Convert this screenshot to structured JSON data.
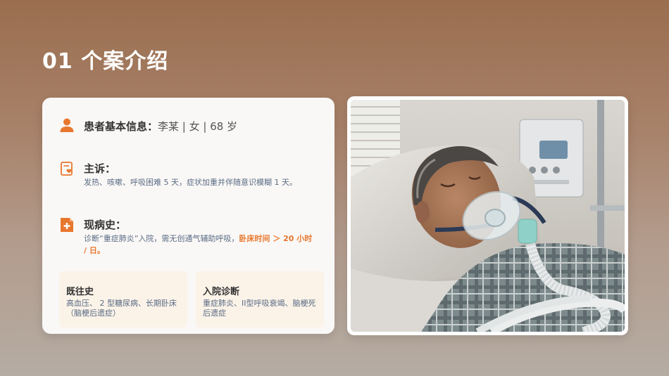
{
  "title": "01  个案介绍",
  "patient": {
    "label": "患者基本信息：",
    "value": "李某 | 女 | 68 岁",
    "icon": "person-icon"
  },
  "complaint": {
    "label": "主诉：",
    "text": "发热、咳嗽、呼吸困难 5 天，症状加重并伴随意识模糊 1 天。",
    "icon": "clipboard-heart-icon"
  },
  "history": {
    "label": "现病史：",
    "text": "诊断“重症肺炎”入院，需无创通气辅助呼吸，",
    "highlight": "卧床时间 ＞ 20 小时 / 日。",
    "icon": "medical-file-icon"
  },
  "past": {
    "label": "既往史",
    "text": "高血压、 2 型糖尿病、长期卧床（脑梗后遗症）"
  },
  "diagnosis": {
    "label": "入院诊断",
    "text": "重症肺炎、II型呼吸衰竭、脑梗死后遗症"
  },
  "colors": {
    "accent": "#e8772e",
    "body_text": "#5a6b85"
  }
}
